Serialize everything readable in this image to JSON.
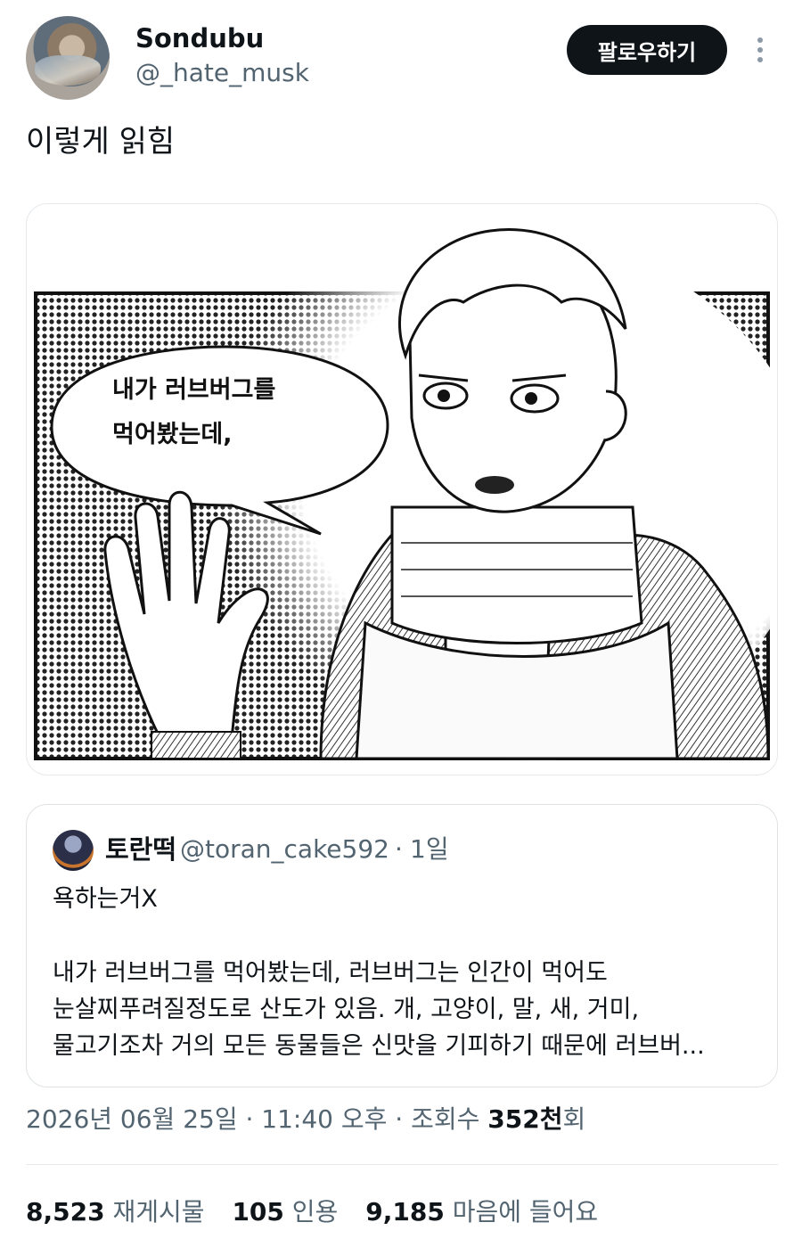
{
  "author": {
    "display_name": "Sondubu",
    "handle": "@_hate_musk"
  },
  "follow_button_label": "팔로우하기",
  "more_icon": "more-vertical-icon",
  "tweet": {
    "text": "이렇게 읽힘"
  },
  "media": {
    "speech_bubble_lines": [
      "내가 러브버그를",
      "먹어봤는데,"
    ]
  },
  "quoted_tweet": {
    "display_name": "토란떡",
    "handle": "@toran_cake592",
    "separator": "·",
    "time": "1일",
    "first_line": "욕하는거X",
    "body_lines": [
      "내가 러브버그를 먹어봤는데, 러브버그는 인간이 먹어도",
      "눈살찌푸려질정도로 산도가 있음. 개, 고양이, 말, 새, 거미,",
      "물고기조차 거의 모든 동물들은 신맛을 기피하기 때문에 러브버..."
    ]
  },
  "meta": {
    "datetime": "2026년 06월 25일 · 11:40 오후 · 조회수 ",
    "views_value": "352천",
    "views_suffix": "회"
  },
  "stats": [
    {
      "value": "8,523",
      "label": "재게시물"
    },
    {
      "value": "105",
      "label": "인용"
    },
    {
      "value": "9,185",
      "label": "마음에 들어요"
    }
  ]
}
